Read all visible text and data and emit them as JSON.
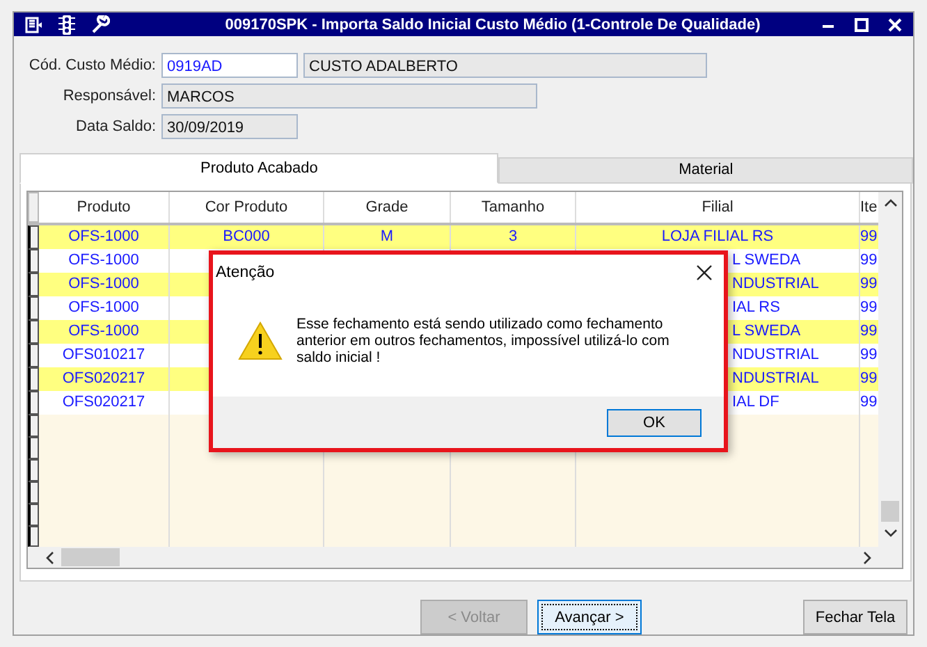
{
  "window": {
    "title": "009170SPK - Importa Saldo Inicial Custo Médio (1-Controle De Qualidade)"
  },
  "form": [
    {
      "label": "Cód. Custo Médio:",
      "value": "0919AD",
      "extra": "CUSTO ADALBERTO",
      "editable": true
    },
    {
      "label": "Responsável:",
      "value": "MARCOS",
      "editable": false
    },
    {
      "label": "Data Saldo:",
      "value": "30/09/2019",
      "editable": false
    }
  ],
  "tabs": [
    {
      "label": "Produto Acabado",
      "selected": true
    },
    {
      "label": "Material",
      "selected": false
    }
  ],
  "table": {
    "columns": [
      "Produto",
      "Cor Produto",
      "Grade",
      "Tamanho",
      "Filial",
      "Ite"
    ],
    "rows": [
      {
        "produto": "OFS-1000",
        "cor": "BC000",
        "grade": "M",
        "tamanho": "3",
        "filial": "LOJA FILIAL RS",
        "filial_clipped": false,
        "item": "99"
      },
      {
        "produto": "OFS-1000",
        "filial": "L SWEDA",
        "filial_clipped": true,
        "item": "99"
      },
      {
        "produto": "OFS-1000",
        "filial": "NDUSTRIAL",
        "filial_clipped": true,
        "item": "99"
      },
      {
        "produto": "OFS-1000",
        "filial": "IAL RS",
        "filial_clipped": true,
        "item": "99"
      },
      {
        "produto": "OFS-1000",
        "filial": "L SWEDA",
        "filial_clipped": true,
        "item": "99"
      },
      {
        "produto": "OFS010217",
        "filial": "NDUSTRIAL",
        "filial_clipped": true,
        "item": "99"
      },
      {
        "produto": "OFS020217",
        "filial": "NDUSTRIAL",
        "filial_clipped": true,
        "item": "99"
      },
      {
        "produto": "OFS020217",
        "filial": "IAL DF",
        "filial_clipped": true,
        "item": "99"
      }
    ]
  },
  "buttons": [
    {
      "label": "< Voltar",
      "disabled": true,
      "focused": false
    },
    {
      "label": "Avançar >",
      "disabled": false,
      "focused": true
    },
    {
      "label": "Fechar Tela",
      "disabled": false,
      "focused": false
    }
  ],
  "dialog": {
    "title": "Atenção",
    "message": "Esse fechamento está sendo utilizado como fechamento anterior em outros fechamentos, impossível utilizá-lo com saldo inicial !",
    "button": "OK"
  }
}
